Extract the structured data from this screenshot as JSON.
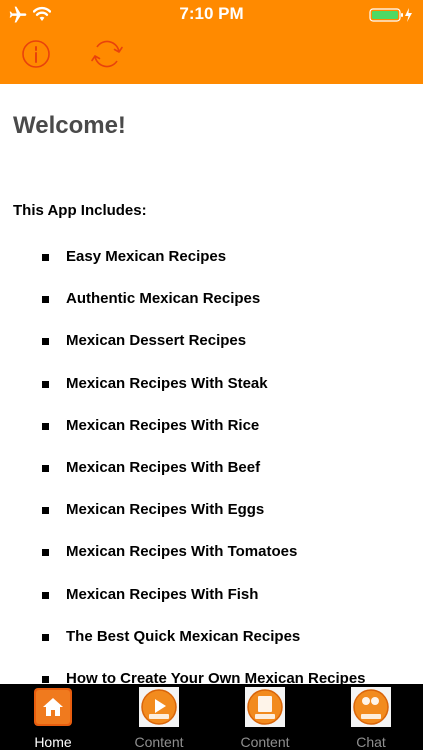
{
  "status_bar": {
    "time": "7:10 PM",
    "icons": [
      "airplane-icon",
      "wifi-icon",
      "battery-charging-icon"
    ]
  },
  "header": {
    "color": "#ff8a00",
    "buttons": [
      "info-icon",
      "refresh-icon"
    ]
  },
  "main": {
    "title": "Welcome!",
    "intro": "This App Includes:",
    "items": [
      "Easy Mexican Recipes",
      "Authentic Mexican Recipes",
      "Mexican Dessert Recipes",
      "Mexican Recipes With Steak",
      "Mexican Recipes With Rice",
      "Mexican Recipes With Beef",
      "Mexican Recipes With Eggs",
      "Mexican Recipes With Tomatoes",
      "Mexican Recipes With Fish",
      "The Best Quick Mexican Recipes",
      "How to Create Your Own Mexican Recipes"
    ]
  },
  "tab_bar": {
    "tabs": [
      {
        "label": "Home",
        "icon": "home-icon",
        "active": true
      },
      {
        "label": "Content",
        "icon": "video-icon",
        "active": false
      },
      {
        "label": "Content",
        "icon": "read-icon",
        "active": false
      },
      {
        "label": "Chat",
        "icon": "chat-icon",
        "active": false
      }
    ]
  }
}
